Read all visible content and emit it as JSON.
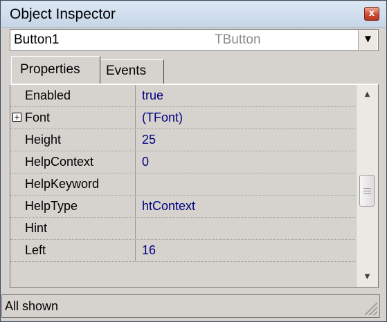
{
  "window": {
    "title": "Object Inspector",
    "close_glyph": "x"
  },
  "object_selector": {
    "name": "Button1",
    "type": "TButton",
    "dropdown_glyph": "▼"
  },
  "tabs": [
    {
      "label": "Properties",
      "active": true
    },
    {
      "label": "Events",
      "active": false
    }
  ],
  "properties": [
    {
      "name": "Enabled",
      "value": "true"
    },
    {
      "name": "Font",
      "value": "(TFont)",
      "expandable": true
    },
    {
      "name": "Height",
      "value": "25"
    },
    {
      "name": "HelpContext",
      "value": "0"
    },
    {
      "name": "HelpKeyword",
      "value": ""
    },
    {
      "name": "HelpType",
      "value": "htContext"
    },
    {
      "name": "Hint",
      "value": ""
    },
    {
      "name": "Left",
      "value": "16"
    }
  ],
  "scrollbar": {
    "up_glyph": "▲",
    "down_glyph": "▼"
  },
  "status": {
    "text": "All shown"
  },
  "colors": {
    "value_text": "#00007f",
    "panel_bg": "#d6d3ce",
    "title_bg": "#c6d6e8",
    "close_button": "#cf4a32"
  },
  "icons": {
    "close": "close-icon",
    "dropdown": "chevron-down-icon",
    "expand": "plus-box-icon",
    "size_grip": "size-grip-icon"
  }
}
